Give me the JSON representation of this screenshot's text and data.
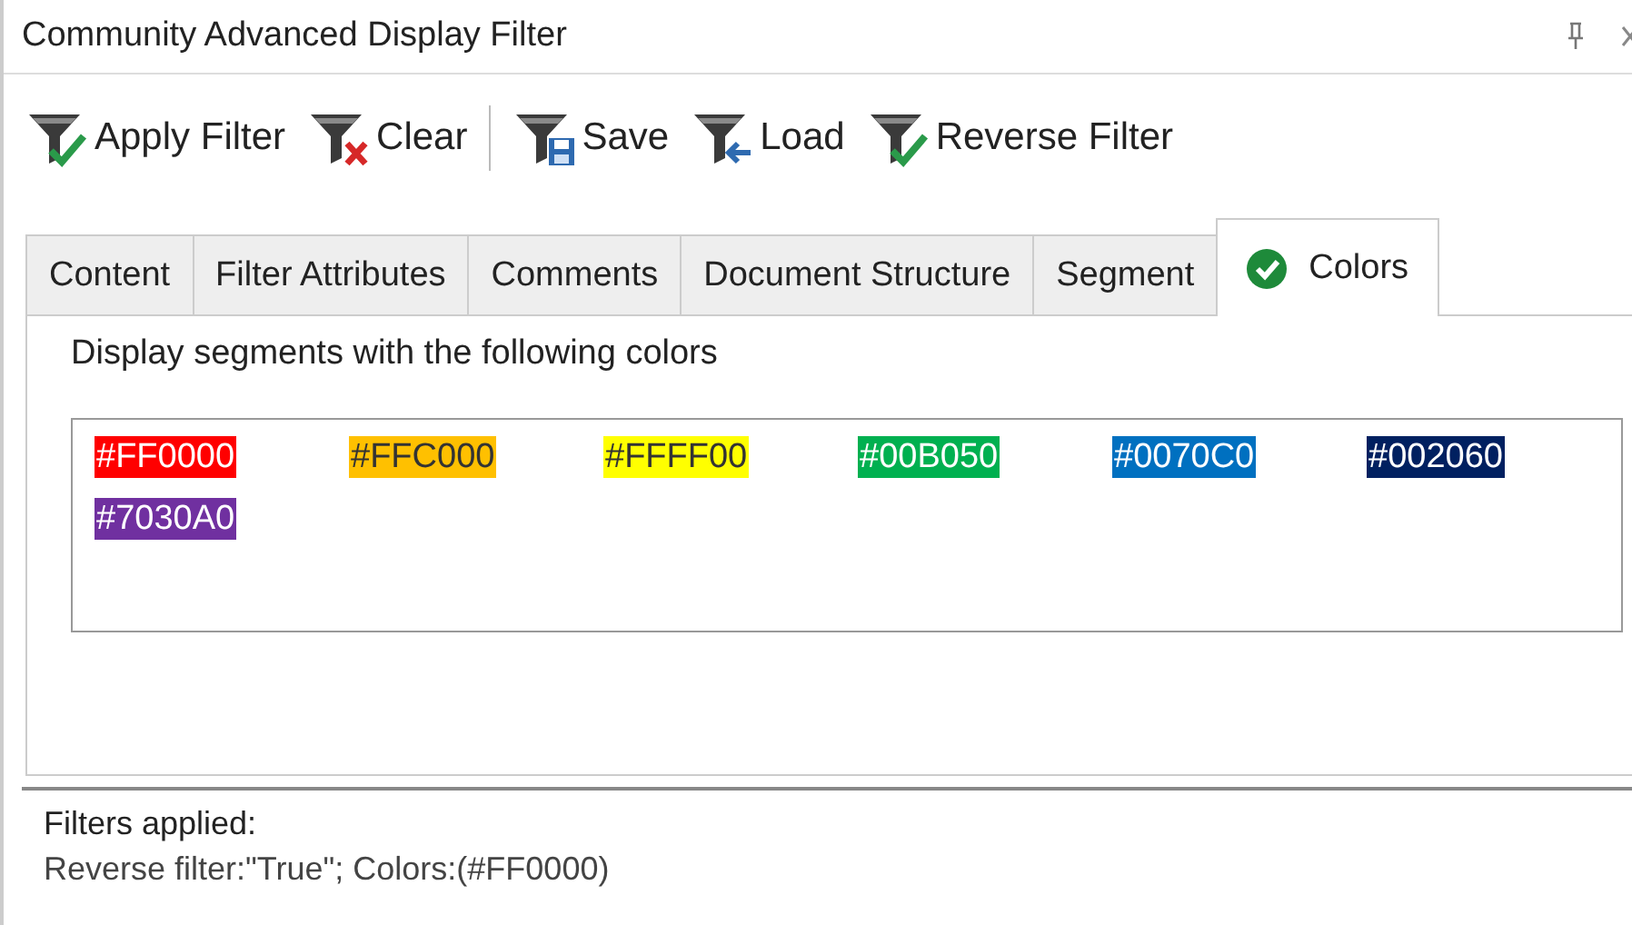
{
  "window": {
    "title": "Community Advanced Display Filter"
  },
  "toolbar": [
    {
      "label": "Apply Filter",
      "kind": "apply"
    },
    {
      "label": "Clear",
      "kind": "clear"
    },
    {
      "label": "Save",
      "kind": "save"
    },
    {
      "label": "Load",
      "kind": "load"
    },
    {
      "label": "Reverse Filter",
      "kind": "apply"
    }
  ],
  "tabs": [
    {
      "label": "Content",
      "selected": false
    },
    {
      "label": "Filter Attributes",
      "selected": false
    },
    {
      "label": "Comments",
      "selected": false
    },
    {
      "label": "Document Structure",
      "selected": false
    },
    {
      "label": "Segment",
      "selected": false
    },
    {
      "label": "Colors",
      "selected": true,
      "checked": true
    }
  ],
  "panel": {
    "caption": "Display segments with the following colors",
    "colors": [
      {
        "label": "#FF0000",
        "color": "#ff0000"
      },
      {
        "label": "#FFC000",
        "color": "#ffc000"
      },
      {
        "label": "#FFFF00",
        "color": "#ffff00"
      },
      {
        "label": "#00B050",
        "color": "#00b050"
      },
      {
        "label": "#0070C0",
        "color": "#0070c0"
      },
      {
        "label": "#002060",
        "color": "#002060"
      },
      {
        "label": "#7030A0",
        "color": "#7030a0"
      }
    ]
  },
  "status": {
    "heading": "Filters applied:",
    "text": "Reverse filter:\"True\"; Colors:(#FF0000)"
  }
}
